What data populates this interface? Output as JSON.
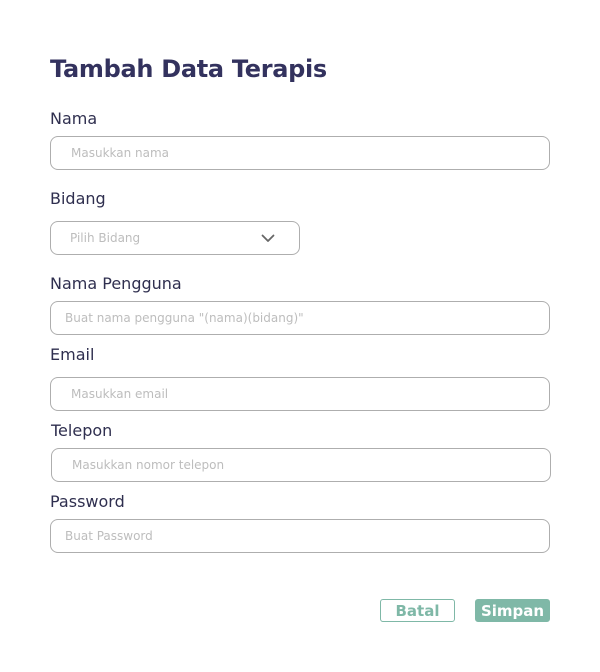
{
  "form": {
    "title": "Tambah Data Terapis",
    "nama": {
      "label": "Nama",
      "placeholder": "Masukkan nama",
      "value": ""
    },
    "bidang": {
      "label": "Bidang",
      "selected": "Pilih Bidang"
    },
    "username": {
      "label": "Nama Pengguna",
      "placeholder": "Buat nama pengguna \"(nama)(bidang)\"",
      "value": ""
    },
    "email": {
      "label": "Email",
      "placeholder": "Masukkan email",
      "value": ""
    },
    "telepon": {
      "label": "Telepon",
      "placeholder": "Masukkan nomor telepon",
      "value": ""
    },
    "password": {
      "label": "Password",
      "placeholder": "Buat Password",
      "value": ""
    }
  },
  "actions": {
    "cancel_label": "Batal",
    "save_label": "Simpan"
  },
  "colors": {
    "title": "#33325e",
    "accent": "#7fb8a7",
    "border": "#aeaeae",
    "placeholder": "#bdbdbd"
  },
  "icons": {
    "dropdown": "chevron-down-icon"
  }
}
